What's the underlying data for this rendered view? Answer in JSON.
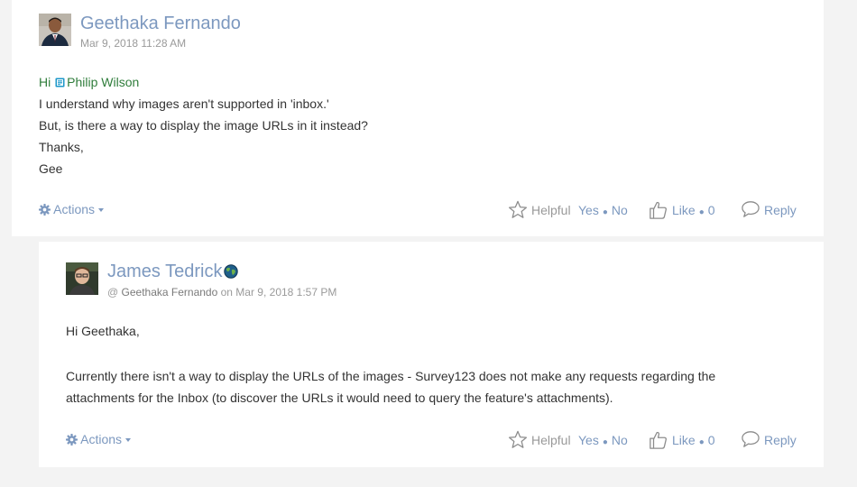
{
  "posts": [
    {
      "author": "Geethaka Fernando",
      "timestamp": "Mar 9, 2018 11:28 AM",
      "avatar": "avatar-geethaka",
      "body": {
        "greeting": "Hi",
        "mention": "Philip Wilson",
        "line1": "I understand why images aren't supported in 'inbox.'",
        "line2": "But, is there a way to display the image URLs in it instead?",
        "line3": "Thanks,",
        "line4": "Gee"
      },
      "actions_label": "Actions",
      "helpful_label": "Helpful",
      "yes_label": "Yes",
      "no_label": "No",
      "like_label": "Like",
      "like_count": "0",
      "reply_label": "Reply"
    },
    {
      "author": "James Tedrick",
      "reply_to_prefix": "@",
      "reply_to_name": "Geethaka Fernando",
      "timestamp_text": "on Mar 9, 2018 1:57 PM",
      "avatar": "avatar-james",
      "body": {
        "greeting": "Hi Geethaka,",
        "line1": "Currently there isn't a way to display the URLs of the images - Survey123 does not make any requests regarding the",
        "line2": "attachments for the Inbox (to discover the URLs it would need to query the feature's attachments)."
      },
      "actions_label": "Actions",
      "helpful_label": "Helpful",
      "yes_label": "Yes",
      "no_label": "No",
      "like_label": "Like",
      "like_count": "0",
      "reply_label": "Reply"
    }
  ],
  "colors": {
    "link": "#7c98bf",
    "mention": "#2f7d3b",
    "muted": "#999999",
    "background": "#f3f3f3"
  },
  "icons": [
    "gear-icon",
    "star-icon",
    "thumbs-up-icon",
    "speech-bubble-icon",
    "mention-user-icon",
    "globe-badge-icon"
  ]
}
